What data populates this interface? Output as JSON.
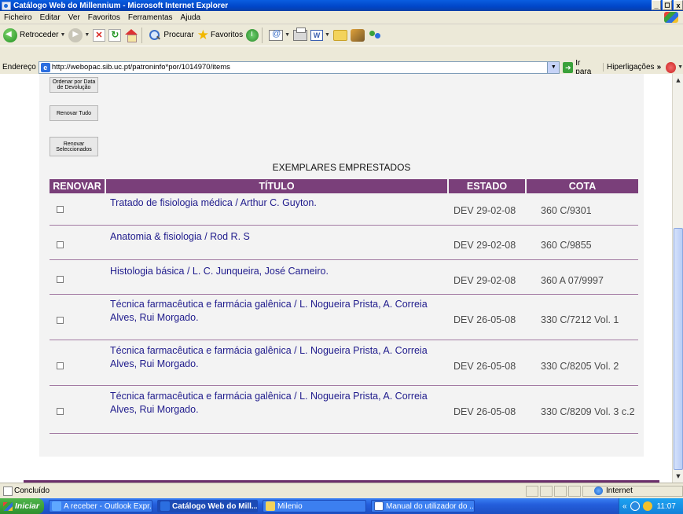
{
  "window": {
    "title": "Catálogo Web do Millennium - Microsoft Internet Explorer",
    "minimize": "_",
    "maximize": "◻",
    "close": "x"
  },
  "menu": [
    "Ficheiro",
    "Editar",
    "Ver",
    "Favoritos",
    "Ferramentas",
    "Ajuda"
  ],
  "toolbar": {
    "back_label": "Retroceder",
    "search_label": "Procurar",
    "favorites_label": "Favoritos",
    "word_glyph": "W"
  },
  "address": {
    "label": "Endereço",
    "url": "http://webopac.sib.uc.pt/patroninfo*por/1014970/items",
    "go_label": "Ir para",
    "links_label": "Hiperligações",
    "chevron": "»"
  },
  "page": {
    "sort_button": "Ordenar por Data de Devolução",
    "renew_all_button": "Renovar Tudo",
    "renew_selected_button": "Renovar Seleccionados",
    "list_title": "EXEMPLARES EMPRESTADOS",
    "columns": [
      "RENOVAR",
      "TÍTULO",
      "ESTADO",
      "COTA"
    ],
    "items": [
      {
        "title": "Tratado de fisiologia médica / Arthur C. Guyton.",
        "status": "DEV 29-02-08",
        "call_number": "360 C/9301"
      },
      {
        "title": "Anatomia & fisiologia / Rod R. S",
        "status": "DEV 29-02-08",
        "call_number": "360 C/9855"
      },
      {
        "title": "Histologia básica / L. C. Junqueira, José Carneiro.",
        "status": "DEV 29-02-08",
        "call_number": "360 A 07/9997"
      },
      {
        "title": "Técnica farmacêutica e farmácia galênica / L. Nogueira Prista, A. Correia Alves, Rui Morgado.",
        "status": "DEV 26-05-08",
        "call_number": "330 C/7212 Vol. 1"
      },
      {
        "title": "Técnica farmacêutica e farmácia galênica / L. Nogueira Prista, A. Correia Alves, Rui Morgado.",
        "status": "DEV 26-05-08",
        "call_number": "330 C/8205 Vol. 2"
      },
      {
        "title": "Técnica farmacêutica e farmácia galênica / L. Nogueira Prista, A. Correia Alves, Rui Morgado.",
        "status": "DEV 26-05-08",
        "call_number": "330 C/8209 Vol. 3 c.2"
      }
    ]
  },
  "status": {
    "text": "Concluído",
    "zone": "Internet"
  },
  "taskbar": {
    "start": "Iniciar",
    "tasks": [
      {
        "label": "A receber - Outlook Expr..."
      },
      {
        "label": "Catálogo Web do Mill..."
      },
      {
        "label": "Milenio"
      },
      {
        "label": "Manual do utilizador do ..."
      }
    ],
    "tray_arrows": "«",
    "clock": "11:07"
  },
  "colors": {
    "header_purple": "#7a3f7a",
    "link_blue": "#1f1b8c"
  }
}
